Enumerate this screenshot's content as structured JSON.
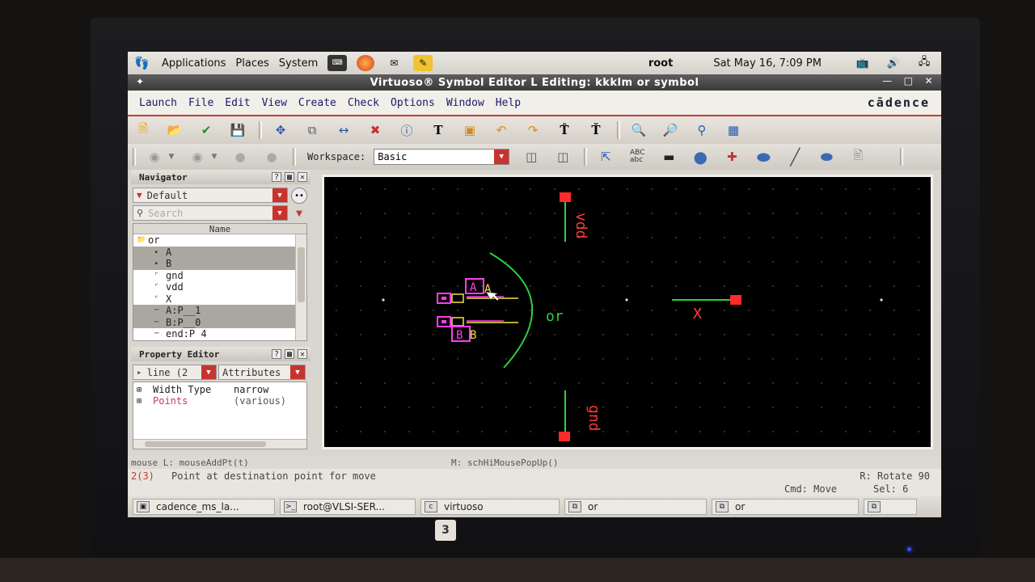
{
  "top_panel": {
    "menus": [
      "Applications",
      "Places",
      "System"
    ],
    "user": "root",
    "clock": "Sat May 16,  7:09 PM"
  },
  "window": {
    "title": "Virtuoso® Symbol Editor L Editing: kkklm or symbol"
  },
  "menu_bar": {
    "items": [
      "Launch",
      "File",
      "Edit",
      "View",
      "Create",
      "Check",
      "Options",
      "Window",
      "Help"
    ],
    "brand": "cādence"
  },
  "toolbar2": {
    "workspace_label": "Workspace:",
    "workspace_value": "Basic"
  },
  "navigator": {
    "title": "Navigator",
    "filter": "Default",
    "search_placeholder": "Search",
    "column": "Name",
    "rows": [
      {
        "label": "or",
        "selected": false,
        "root": true
      },
      {
        "label": "A",
        "selected": true
      },
      {
        "label": "B",
        "selected": true
      },
      {
        "label": "gnd",
        "selected": false
      },
      {
        "label": "vdd",
        "selected": false
      },
      {
        "label": "X",
        "selected": false
      },
      {
        "label": "A:P__1",
        "selected": true
      },
      {
        "label": "B:P__0",
        "selected": true
      },
      {
        "label": "end:P  4",
        "selected": false
      }
    ]
  },
  "property_editor": {
    "title": "Property Editor",
    "object": "line (2",
    "mode": "Attributes",
    "rows": [
      {
        "key": "Width Type",
        "value": "narrow"
      },
      {
        "key": "Points",
        "value": "(various)"
      }
    ]
  },
  "canvas": {
    "labels": {
      "vdd": "vdd",
      "gnd": "gnd",
      "or": "or",
      "x": "X",
      "a": "A",
      "b": "B"
    }
  },
  "status": {
    "mouse_left": "mouse L: mouseAddPt(t)",
    "mouse_mid": "M: schHiMousePopUp()",
    "prompt_num": "2(3)",
    "prompt": "Point at destination point for move",
    "rotate": "R: Rotate 90",
    "cmd": "Cmd: Move",
    "sel": "Sel: 6"
  },
  "taskbar": {
    "tasks": [
      "cadence_ms_la...",
      "root@VLSI-SER...",
      "virtuoso",
      "or",
      "or"
    ]
  },
  "monitor": {
    "badge": "3"
  },
  "colors": {
    "accent_red": "#c8332f",
    "pin_red": "#ff2a2a",
    "wire_green": "#2ad13a",
    "label_magenta": "#ff3df0",
    "label_yellow": "#f5e23a"
  }
}
